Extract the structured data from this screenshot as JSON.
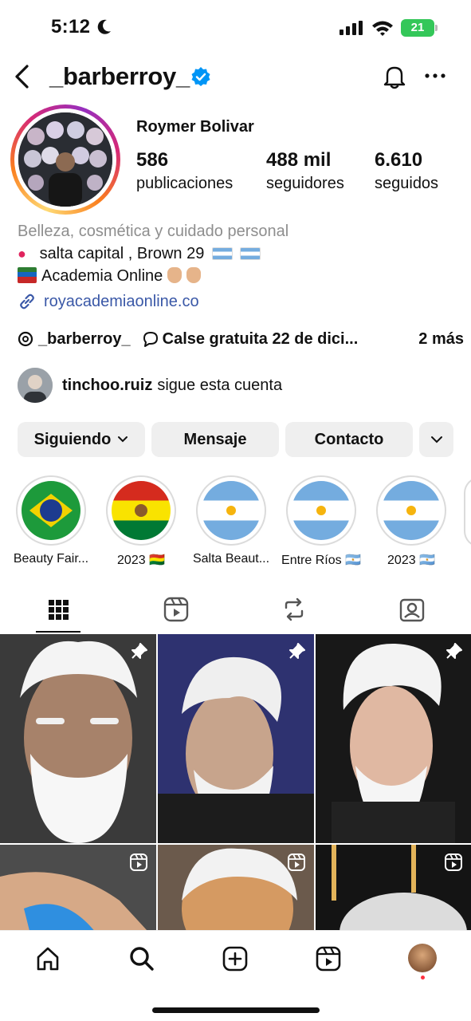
{
  "status_bar": {
    "time": "5:12",
    "battery": "21"
  },
  "header": {
    "username": "_barberroy_"
  },
  "profile": {
    "display_name": "Roymer Bolivar",
    "stats": [
      {
        "value": "586",
        "label": "publicaciones"
      },
      {
        "value": "488 mil",
        "label": "seguidores"
      },
      {
        "value": "6.610",
        "label": "seguidos"
      }
    ],
    "category": "Belleza, cosmética y cuidado personal",
    "bio_line_1": "salta capital , Brown 29",
    "bio_line_2": "Academia Online",
    "link": "royacademiaonline.co",
    "threads_handle": "_barberroy_",
    "channel": "Calse gratuita 22 de dici...",
    "more_links": "2 más",
    "followed_by_name": "tinchoo.ruiz",
    "followed_by_text": "sigue esta cuenta"
  },
  "buttons": {
    "following": "Siguiendo",
    "message": "Mensaje",
    "contact": "Contacto"
  },
  "highlights": [
    {
      "label": "Beauty Fair...",
      "flag": "brazil"
    },
    {
      "label": "2023 🇧🇴",
      "flag": "bolivia"
    },
    {
      "label": "Salta Beaut...",
      "flag": "argentina"
    },
    {
      "label": "Entre Ríos 🇦🇷",
      "flag": "argentina"
    },
    {
      "label": "2023 🇦🇷",
      "flag": "argentina"
    }
  ],
  "tabs": [
    "grid-icon",
    "reels-icon",
    "reposts-icon",
    "tagged-icon"
  ],
  "grid_posts": [
    {
      "type": "pinned",
      "icon": "pin-icon"
    },
    {
      "type": "pinned",
      "icon": "pin-icon"
    },
    {
      "type": "pinned",
      "icon": "pin-icon"
    },
    {
      "type": "reel",
      "icon": "reel-icon"
    },
    {
      "type": "reel",
      "icon": "reel-icon"
    },
    {
      "type": "reel",
      "icon": "reel-icon"
    }
  ],
  "bottom_nav": [
    "home-icon",
    "search-icon",
    "create-icon",
    "reels-icon",
    "profile-avatar"
  ],
  "colors": {
    "verified": "#0095f6",
    "link": "#3a58a7",
    "button_bg": "#efefef",
    "battery": "#34c759",
    "notification_dot": "#ff3040"
  }
}
